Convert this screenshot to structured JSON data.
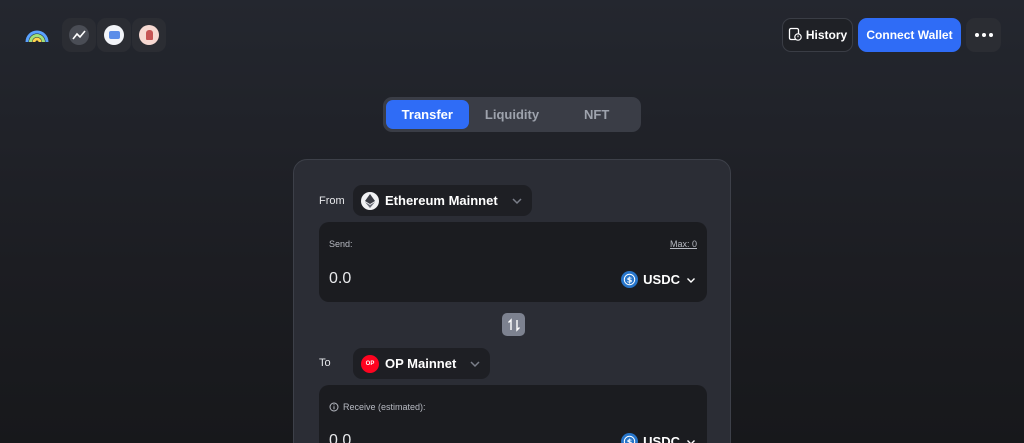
{
  "header": {
    "history_label": "History",
    "connect_label": "Connect Wallet"
  },
  "tabs": [
    {
      "label": "Transfer",
      "active": true
    },
    {
      "label": "Liquidity",
      "active": false
    },
    {
      "label": "NFT",
      "active": false
    }
  ],
  "bridge": {
    "from_label": "From",
    "from_network": "Ethereum Mainnet",
    "send_label": "Send:",
    "max_label": "Max: 0",
    "send_amount": "0.0",
    "send_token": "USDC",
    "to_label": "To",
    "to_network": "OP Mainnet",
    "to_network_badge": "OP",
    "receive_label": "Receive (estimated):",
    "receive_amount": "0.0",
    "receive_token": "USDC"
  },
  "colors": {
    "accent": "#2f6cf6",
    "card": "#2b2d35",
    "panel": "#1b1c20",
    "op_red": "#ff0420",
    "usdc_blue": "#2775ca"
  },
  "icons": [
    "rainbow-logo-icon",
    "analytics-app-icon",
    "pool-app-icon",
    "community-app-icon",
    "history-icon",
    "more-icon",
    "ethereum-icon",
    "op-icon",
    "usdc-icon",
    "swap-icon",
    "info-icon",
    "chevron-down-icon"
  ]
}
